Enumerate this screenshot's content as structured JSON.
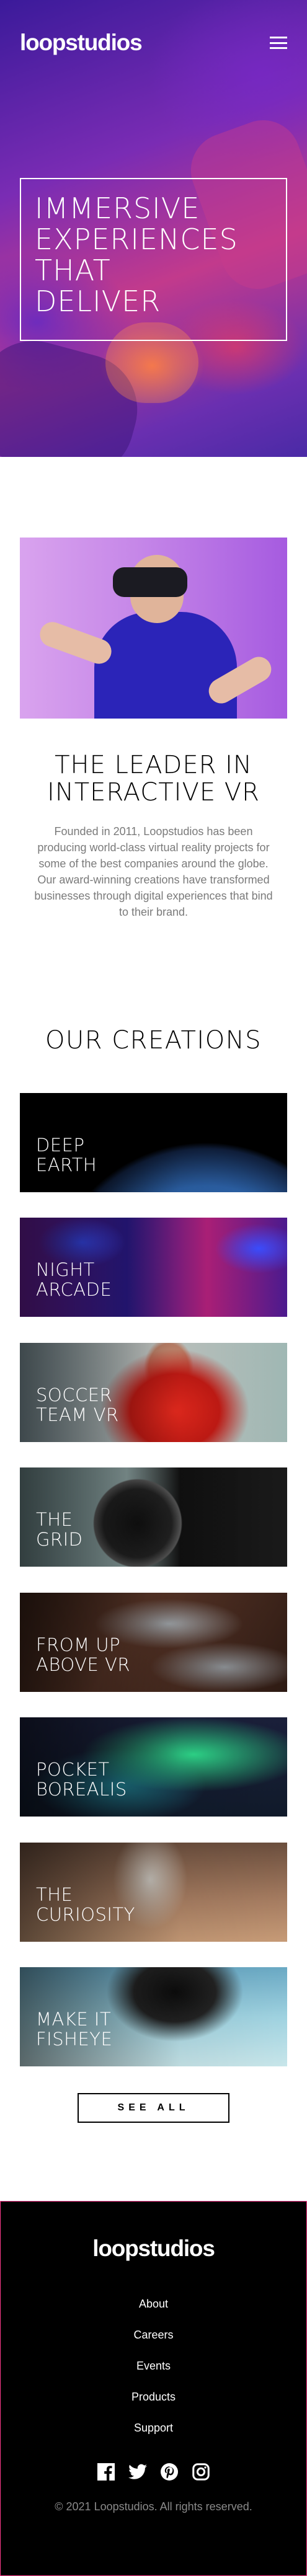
{
  "header": {
    "logo": "loopstudios",
    "menu_icon": "hamburger-menu-icon"
  },
  "hero": {
    "title": "IMMERSIVE\nEXPERIENCES\nTHAT\nDELIVER"
  },
  "interactive": {
    "title": "THE LEADER IN\nINTERACTIVE VR",
    "description": "Founded in 2011, Loopstudios has been producing world-class virtual reality projects for some of the best companies around the globe. Our award-winning creations have transformed businesses through digital experiences that bind to their brand."
  },
  "creations": {
    "title": "OUR CREATIONS",
    "items": [
      {
        "label": "DEEP\nEARTH"
      },
      {
        "label": "NIGHT\nARCADE"
      },
      {
        "label": "SOCCER\nTEAM VR"
      },
      {
        "label": "THE\nGRID"
      },
      {
        "label": "FROM UP\nABOVE VR"
      },
      {
        "label": "POCKET\nBOREALIS"
      },
      {
        "label": "THE\nCURIOSITY"
      },
      {
        "label": "MAKE IT\nFISHEYE"
      }
    ],
    "see_all": "SEE ALL"
  },
  "footer": {
    "logo": "loopstudios",
    "nav": [
      "About",
      "Careers",
      "Events",
      "Products",
      "Support"
    ],
    "social_icons": [
      "facebook-icon",
      "twitter-icon",
      "pinterest-icon",
      "instagram-icon"
    ],
    "copyright": "© 2021 Loopstudios. All rights reserved."
  },
  "colors": {
    "footer_bg": "#000000",
    "footer_border": "#ff3b8c",
    "body_text": "#7a7a7a"
  }
}
